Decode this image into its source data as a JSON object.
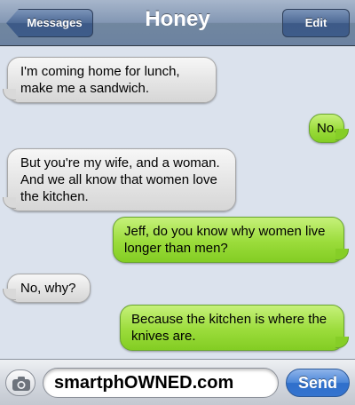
{
  "header": {
    "back_label": "Messages",
    "title": "Honey",
    "edit_label": "Edit"
  },
  "messages": [
    {
      "from": "received",
      "text": "I'm coming home for lunch, make me a sandwich."
    },
    {
      "from": "sent",
      "text": "No."
    },
    {
      "from": "received",
      "text": "But you're my wife, and a woman. And we all know that women love the kitchen."
    },
    {
      "from": "sent",
      "text": "Jeff, do you know why women live longer than men?"
    },
    {
      "from": "received",
      "text": "No, why?"
    },
    {
      "from": "sent",
      "text": "Because the kitchen is where the knives are."
    }
  ],
  "composer": {
    "input_value": "smartphOWNED.com",
    "send_label": "Send",
    "camera_icon": "camera-icon"
  },
  "colors": {
    "sent_bubble": "#9bdc3b",
    "received_bubble": "#e4e4e4",
    "background": "#dbe2ed",
    "send_button": "#3574cf"
  }
}
